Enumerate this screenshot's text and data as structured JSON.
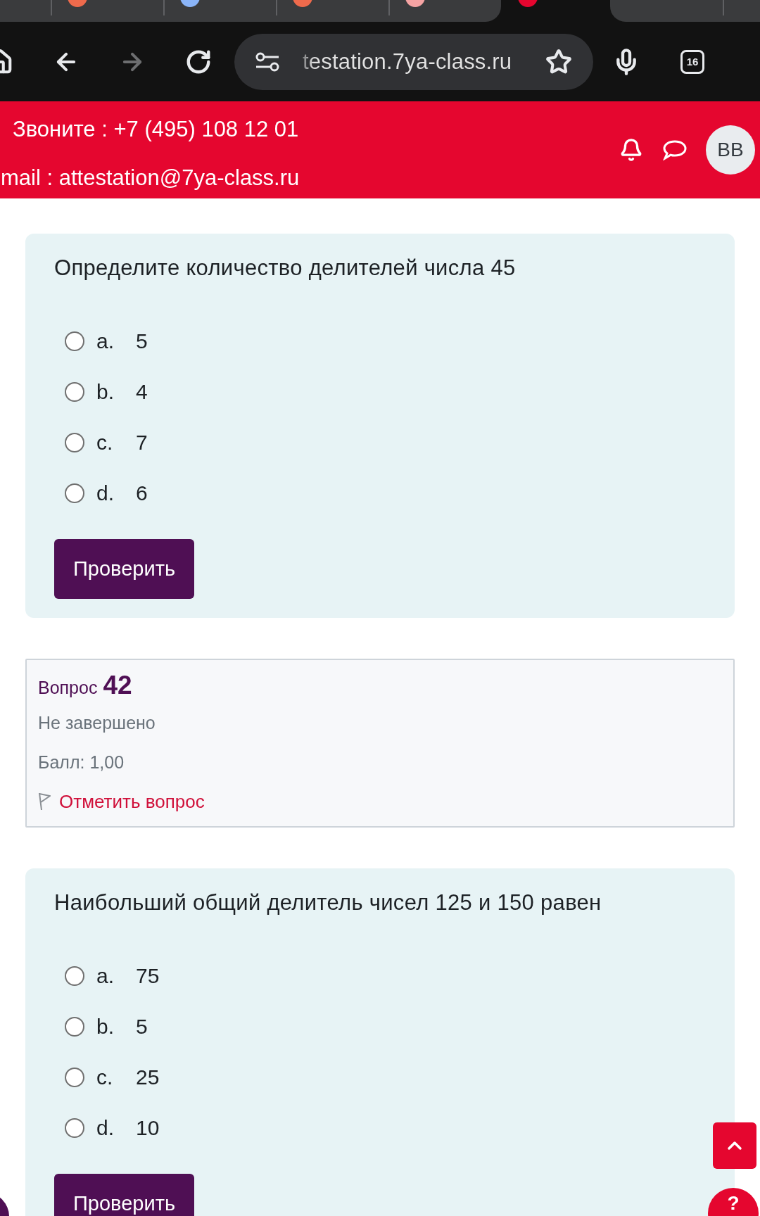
{
  "browser": {
    "tabs": [
      {
        "selected": false
      },
      {
        "selected": false,
        "color": "#ee6a4c"
      },
      {
        "selected": false,
        "color": "#8ab4f8"
      },
      {
        "selected": false,
        "color": "#ee6a4c"
      },
      {
        "selected": false,
        "color": "#f4a3a3"
      },
      {
        "selected": true,
        "color": "#e5062f"
      },
      {
        "selected": false
      },
      {
        "selected": false
      }
    ],
    "toolbar": [
      {
        "kind": "home",
        "disabled": false
      },
      {
        "kind": "back",
        "disabled": false
      },
      {
        "kind": "forward",
        "disabled": true
      },
      {
        "kind": "reload",
        "disabled": false
      }
    ],
    "url": "testation.7ya-class.ru",
    "tab_count": "16"
  },
  "header": {
    "phone": "Звоните : +7 (495) 108 12 01",
    "email": "mail : attestation@7ya-class.ru",
    "avatar": "BB"
  },
  "blocks": [
    {
      "kind": "question",
      "text": "Определите количество делителей числа 45",
      "options": [
        {
          "letter": "a.",
          "value": "5",
          "selected": false
        },
        {
          "letter": "b.",
          "value": "4",
          "selected": false
        },
        {
          "letter": "c.",
          "value": "7",
          "selected": false
        },
        {
          "letter": "d.",
          "value": "6",
          "selected": false
        }
      ],
      "button": "Проверить"
    },
    {
      "kind": "info",
      "label": "Вопрос",
      "number": "42",
      "status": "Не завершено",
      "grade": "Балл: 1,00",
      "flag": "Отметить вопрос"
    },
    {
      "kind": "question",
      "text": "Наибольший общий делитель чисел 125 и 150 равен",
      "options": [
        {
          "letter": "a.",
          "value": "75",
          "selected": false
        },
        {
          "letter": "b.",
          "value": "5",
          "selected": false
        },
        {
          "letter": "c.",
          "value": "25",
          "selected": false
        },
        {
          "letter": "d.",
          "value": "10",
          "selected": false
        }
      ],
      "button": "Проверить"
    }
  ],
  "help_button": "?"
}
